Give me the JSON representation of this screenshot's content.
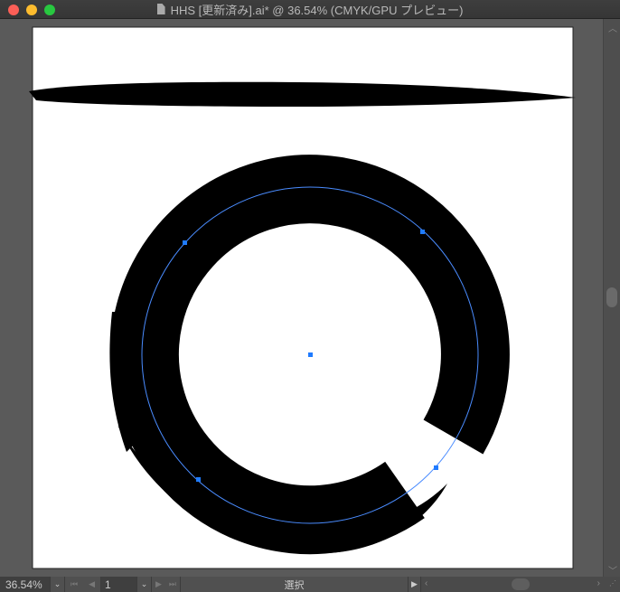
{
  "window": {
    "title": "HHS [更新済み].ai* @ 36.54% (CMYK/GPU プレビュー)"
  },
  "status": {
    "zoom": "36.54%",
    "artboard": "1",
    "tool": "選択"
  },
  "icons": [
    "close-icon",
    "minimize-icon",
    "zoom-icon",
    "document-icon",
    "chevron-down-icon",
    "first-artboard-icon",
    "prev-artboard-icon",
    "next-artboard-icon",
    "last-artboard-icon",
    "play-icon",
    "resize-grip-icon"
  ],
  "colors": {
    "accent": "#4a8cff",
    "ink": "#000000",
    "chrome": "#535353"
  }
}
